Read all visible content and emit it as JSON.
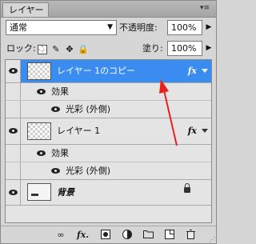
{
  "panel": {
    "tab_label": "レイヤー",
    "tab_close": "×",
    "menu_icon": "▾≡"
  },
  "controls": {
    "blend_mode": "通常",
    "opacity_label": "不透明度:",
    "opacity_value": "100%",
    "lock_label": "ロック:",
    "fill_label": "塗り:",
    "fill_value": "100%"
  },
  "layers": [
    {
      "name": "レイヤー 1のコピー",
      "selected": true,
      "fx": "fx",
      "effects_label": "効果",
      "effect": "光彩 (外側)"
    },
    {
      "name": "レイヤー 1",
      "selected": false,
      "fx": "fx",
      "effects_label": "効果",
      "effect": "光彩 (外側)"
    },
    {
      "name": "背景",
      "selected": false,
      "locked": true
    }
  ],
  "annotation_color": "#e8201c",
  "selection_color": "#3b8cf0",
  "bottom_icons": [
    "link-icon",
    "fx-icon",
    "mask-icon",
    "adjustment-icon",
    "group-folder-icon",
    "new-layer-icon",
    "trash-icon"
  ],
  "bottom_fx": "fx."
}
